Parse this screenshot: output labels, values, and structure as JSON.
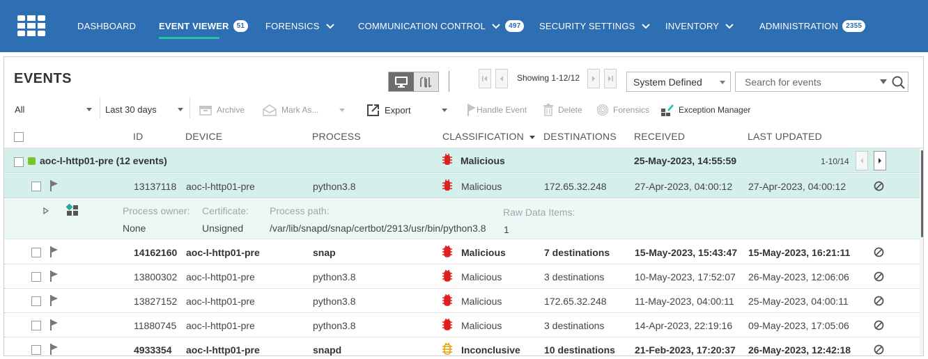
{
  "nav": {
    "items": [
      {
        "label": "DASHBOARD"
      },
      {
        "label": "EVENT VIEWER",
        "badge": "51"
      },
      {
        "label": "FORENSICS"
      },
      {
        "label": "COMMUNICATION CONTROL",
        "badge": "497"
      },
      {
        "label": "SECURITY SETTINGS"
      },
      {
        "label": "INVENTORY"
      },
      {
        "label": "ADMINISTRATION",
        "badge": "2355"
      }
    ]
  },
  "events": {
    "title": "EVENTS",
    "pager_text": "Showing 1-12/12",
    "view_filter": "System Defined",
    "search_placeholder": "Search for events"
  },
  "toolbar": {
    "filter_all": "All",
    "filter_period": "Last 30 days",
    "archive": "Archive",
    "mark_as": "Mark As...",
    "export": "Export",
    "handle_event": "Handle Event",
    "delete": "Delete",
    "forensics": "Forensics",
    "exception_manager": "Exception Manager"
  },
  "columns": {
    "id": "ID",
    "device": "DEVICE",
    "process": "PROCESS",
    "classification": "CLASSIFICATION",
    "destinations": "DESTINATIONS",
    "received": "RECEIVED",
    "last_updated": "LAST UPDATED"
  },
  "group": {
    "name": "aoc-l-http01-pre  (12 events)",
    "classification": "Malicious",
    "received": "25-May-2023, 14:55:59",
    "pager": "1-10/14"
  },
  "detail": {
    "owner_label": "Process owner:",
    "owner_value": "None",
    "cert_label": "Certificate:",
    "cert_value": "Unsigned",
    "path_label": "Process path:",
    "path_value": "/var/lib/snapd/snap/certbot/2913/usr/bin/python3.8",
    "raw_label": "Raw Data Items:",
    "raw_value": "1"
  },
  "rows": [
    {
      "id": "13137118",
      "device": "aoc-l-http01-pre",
      "process": "python3.8",
      "classification": "Malicious",
      "destinations": "172.65.32.248",
      "received": "27-Apr-2023, 04:00:12",
      "last_updated": "27-Apr-2023, 04:00:12"
    },
    {
      "id": "14162160",
      "device": "aoc-l-http01-pre",
      "process": "snap",
      "classification": "Malicious",
      "destinations": "7 destinations",
      "received": "15-May-2023, 15:43:47",
      "last_updated": "15-May-2023, 16:21:11"
    },
    {
      "id": "13800302",
      "device": "aoc-l-http01-pre",
      "process": "python3.8",
      "classification": "Malicious",
      "destinations": "3 destinations",
      "received": "10-May-2023, 17:52:07",
      "last_updated": "26-May-2023, 12:06:06"
    },
    {
      "id": "13827152",
      "device": "aoc-l-http01-pre",
      "process": "python3.8",
      "classification": "Malicious",
      "destinations": "172.65.32.248",
      "received": "11-May-2023, 04:00:11",
      "last_updated": "25-May-2023, 04:00:11"
    },
    {
      "id": "11880745",
      "device": "aoc-l-http01-pre",
      "process": "python3.8",
      "classification": "Malicious",
      "destinations": "3 destinations",
      "received": "14-Apr-2023, 22:19:16",
      "last_updated": "09-May-2023, 17:05:06"
    },
    {
      "id": "4933354",
      "device": "aoc-l-http01-pre",
      "process": "snapd",
      "classification": "Inconclusive",
      "destinations": "10 destinations",
      "received": "21-Feb-2023, 17:20:37",
      "last_updated": "26-May-2023, 12:42:18"
    }
  ],
  "colors": {
    "nav_bg": "#2e6fb4",
    "active_underline": "#26c3a8",
    "row_selected": "#d4efec",
    "malicious": "#e02020",
    "inconclusive": "#e8a000"
  }
}
